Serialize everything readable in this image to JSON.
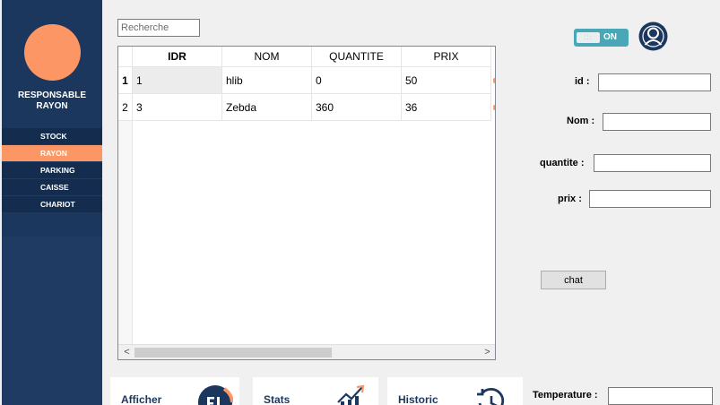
{
  "sidebar": {
    "role_title_line1": "RESPONSABLE",
    "role_title_line2": "RAYON",
    "items": [
      {
        "label": "STOCK",
        "active": false
      },
      {
        "label": "RAYON",
        "active": true
      },
      {
        "label": "PARKING",
        "active": false
      },
      {
        "label": "CAISSE",
        "active": false
      },
      {
        "label": "CHARIOT",
        "active": false
      }
    ]
  },
  "search": {
    "placeholder": "Recherche",
    "value": ""
  },
  "table": {
    "columns": [
      "IDR",
      "NOM",
      "QUANTITE",
      "PRIX"
    ],
    "rows": [
      {
        "header": "1",
        "cells": [
          "1",
          "hlib",
          "0",
          "50"
        ]
      },
      {
        "header": "2",
        "cells": [
          "3",
          "Zebda",
          "360",
          "36"
        ]
      }
    ],
    "scroll_left": "<",
    "scroll_right": ">"
  },
  "toggle": {
    "label": "ON",
    "knob": ":::"
  },
  "form": {
    "id_label": "id :",
    "nom_label": "Nom :",
    "quantite_label": "quantite :",
    "prix_label": "prix :",
    "id_value": "",
    "nom_value": "",
    "quantite_value": "",
    "prix_value": ""
  },
  "chat_button": "chat",
  "cards": {
    "afficher": "Afficher",
    "stats": "Stats",
    "historic": "Historic"
  },
  "temperature": {
    "label": "Temperature :",
    "value": ""
  },
  "colors": {
    "sidebar": "#1c375e",
    "accent": "#fc9765",
    "toggle": "#4aa8b6"
  },
  "icons": [
    "user-icon",
    "chart-icon",
    "history-icon",
    "list-icon"
  ]
}
